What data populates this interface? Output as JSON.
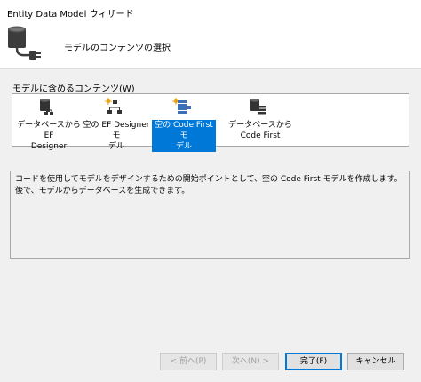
{
  "window": {
    "title": "Entity Data Model ウィザード"
  },
  "header": {
    "subtitle": "モデルのコンテンツの選択"
  },
  "content": {
    "group_label": "モデルに含めるコンテンツ(W)",
    "items": [
      {
        "label": "データベースから EF\nDesigner",
        "icon": "database-designer-icon",
        "selected": false
      },
      {
        "label": "空の EF Designer モ\nデル",
        "icon": "empty-designer-model-icon",
        "selected": false
      },
      {
        "label": "空の Code First モ\nデル",
        "icon": "code-first-model-icon",
        "selected": true
      },
      {
        "label": "データベースから\nCode First",
        "icon": "database-code-first-icon",
        "selected": false
      }
    ],
    "description": "コードを使用してモデルをデザインするための開始ポイントとして、空の Code First モデルを作成します。後で、モデルからデータベースを生成できます。"
  },
  "buttons": {
    "prev": "< 前へ(P)",
    "next": "次へ(N) >",
    "finish": "完了(F)",
    "cancel": "キャンセル"
  },
  "colors": {
    "selection": "#0078d7",
    "dialog_background": "#f0f0f0"
  }
}
